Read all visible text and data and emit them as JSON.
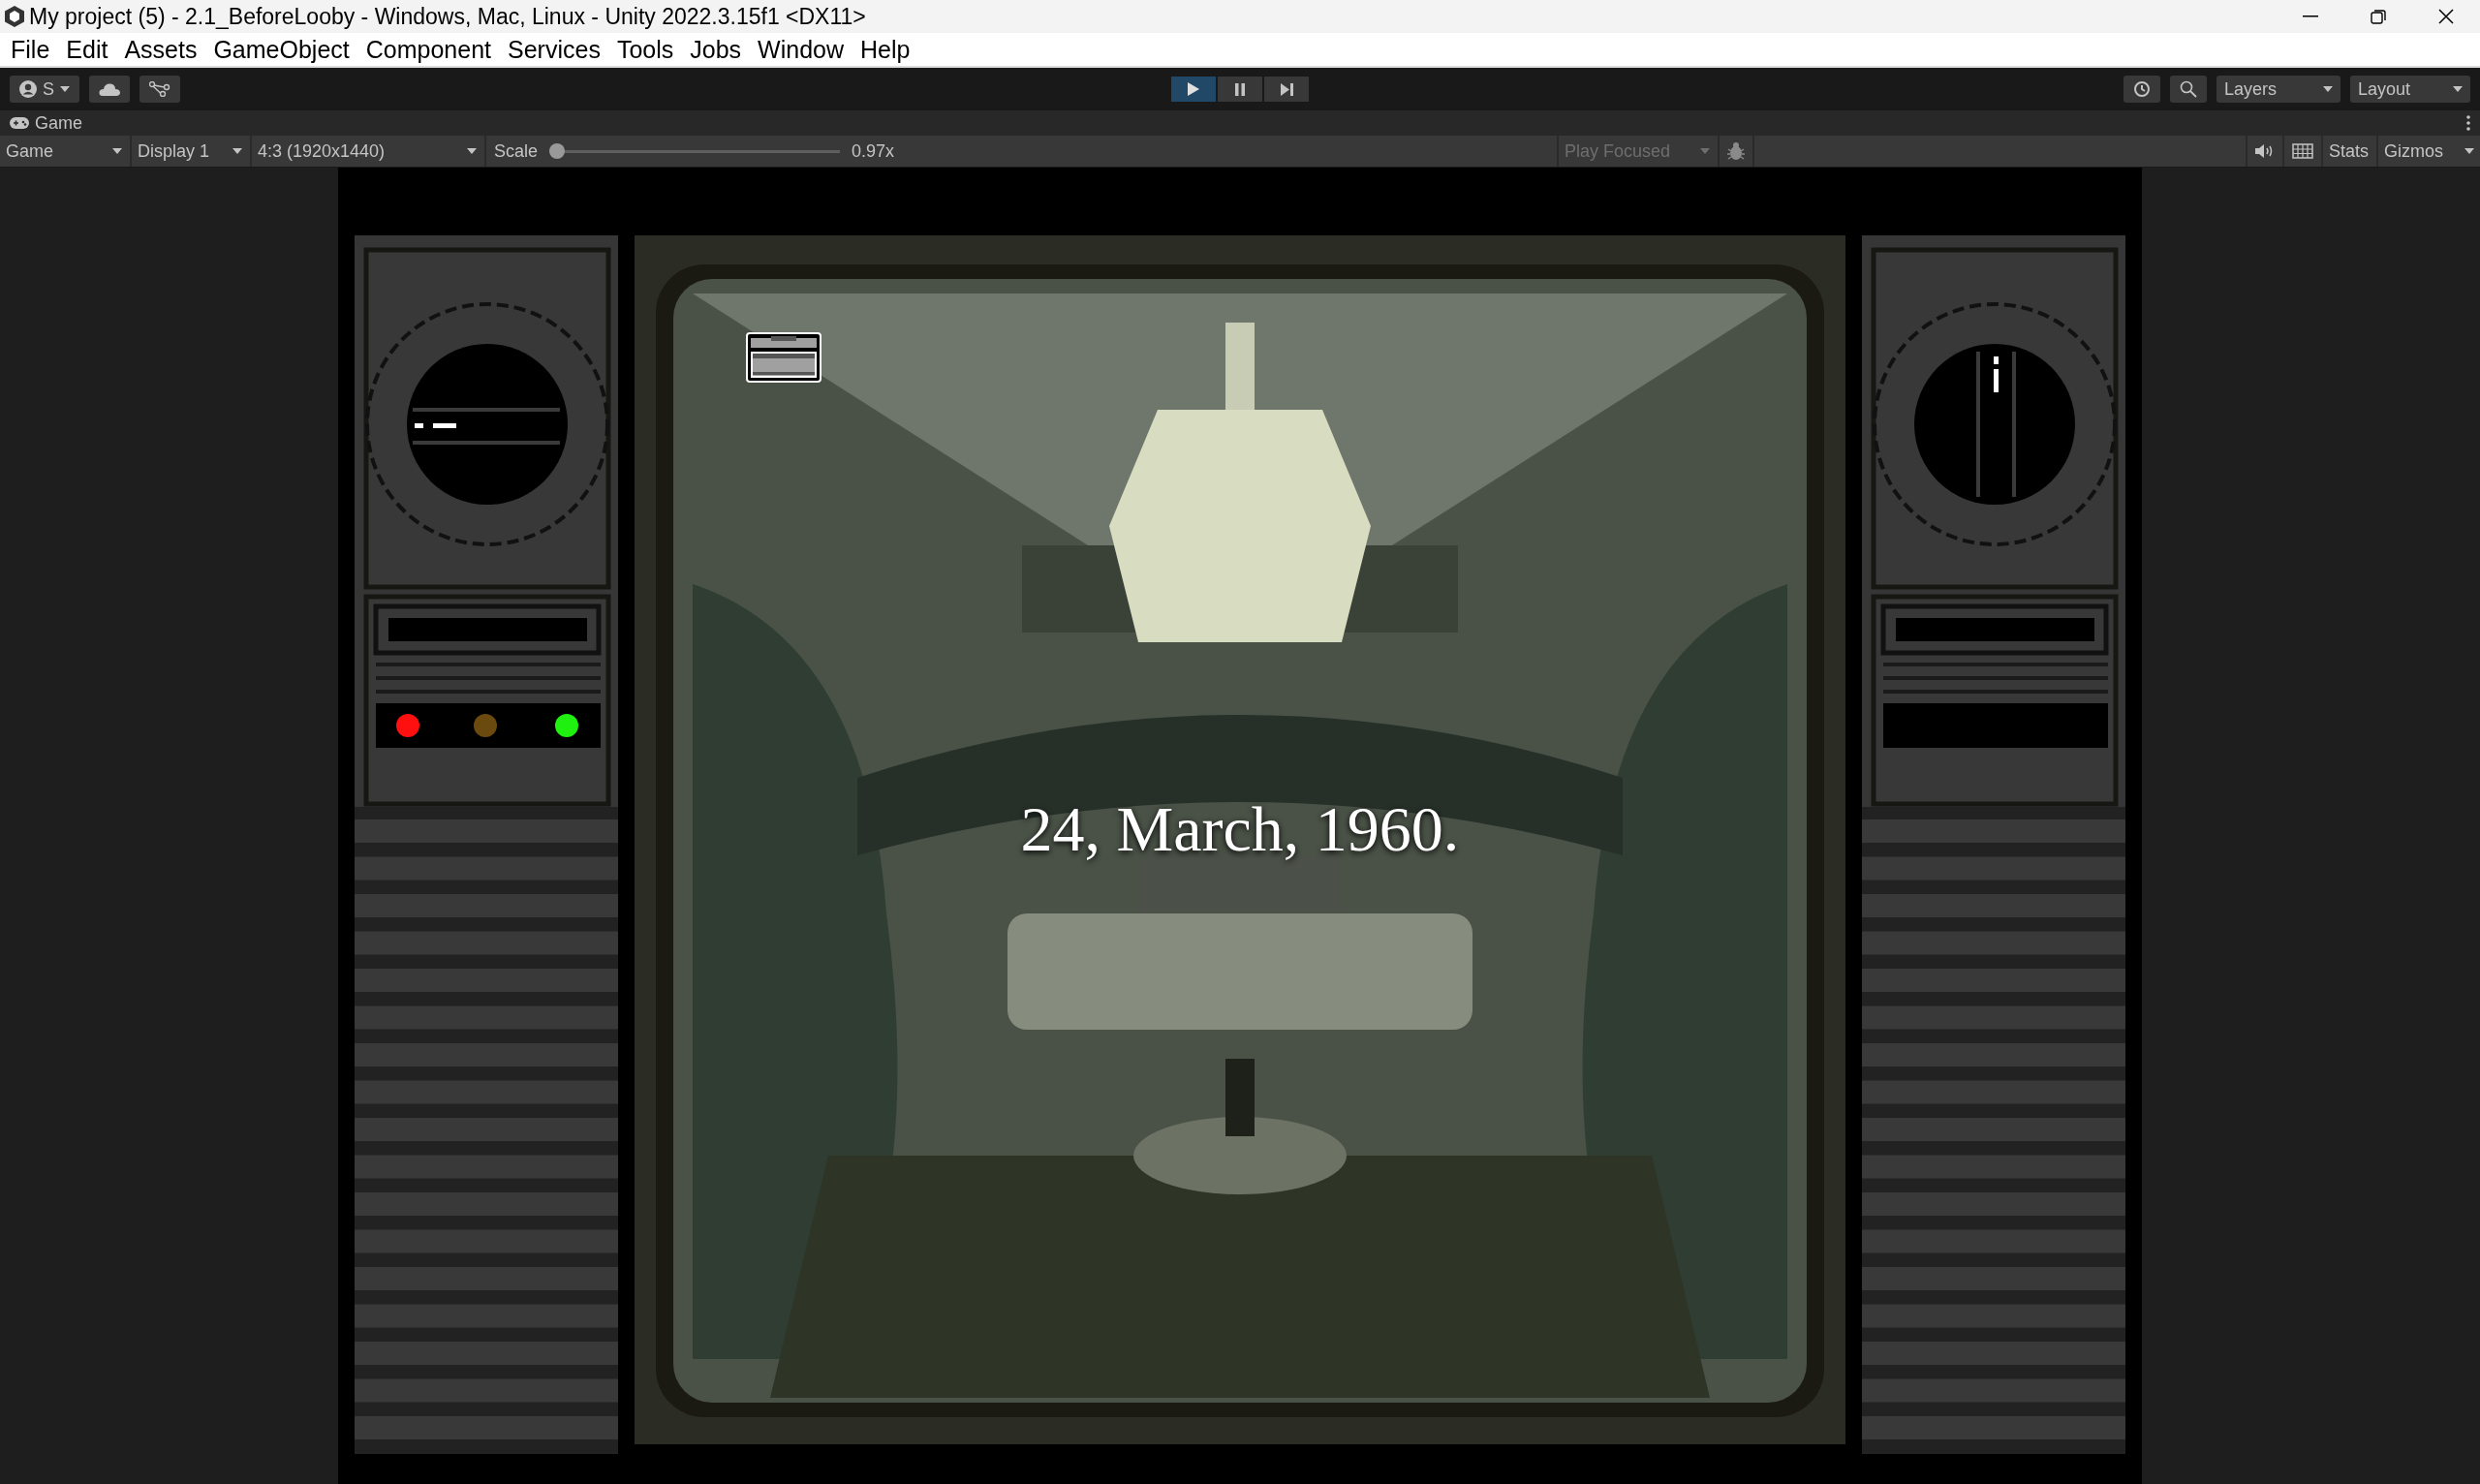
{
  "window": {
    "title": "My project (5) - 2.1_BeforeLooby - Windows, Mac, Linux - Unity 2022.3.15f1 <DX11>"
  },
  "menu": [
    "File",
    "Edit",
    "Assets",
    "GameObject",
    "Component",
    "Services",
    "Tools",
    "Jobs",
    "Window",
    "Help"
  ],
  "toolbar": {
    "account": "S",
    "play": {
      "on": true
    },
    "pause": {
      "on": false
    },
    "layers": "Layers",
    "layout": "Layout"
  },
  "game_tab": {
    "label": "Game"
  },
  "game_toolbar": {
    "view_mode": "Game",
    "display": "Display 1",
    "aspect": "4:3 (1920x1440)",
    "scale_label": "Scale",
    "scale": {
      "level": 0
    },
    "scale_value": "0.97x",
    "play_mode": "Play Focused",
    "stats": "Stats",
    "gizmos": "Gizmos"
  },
  "game_view": {
    "caption": "24, March, 1960.",
    "left_panel": {
      "lights": [
        {
          "color": "#ff1010"
        },
        {
          "color": "#6b4a10"
        },
        {
          "color": "#20f010"
        }
      ]
    }
  }
}
